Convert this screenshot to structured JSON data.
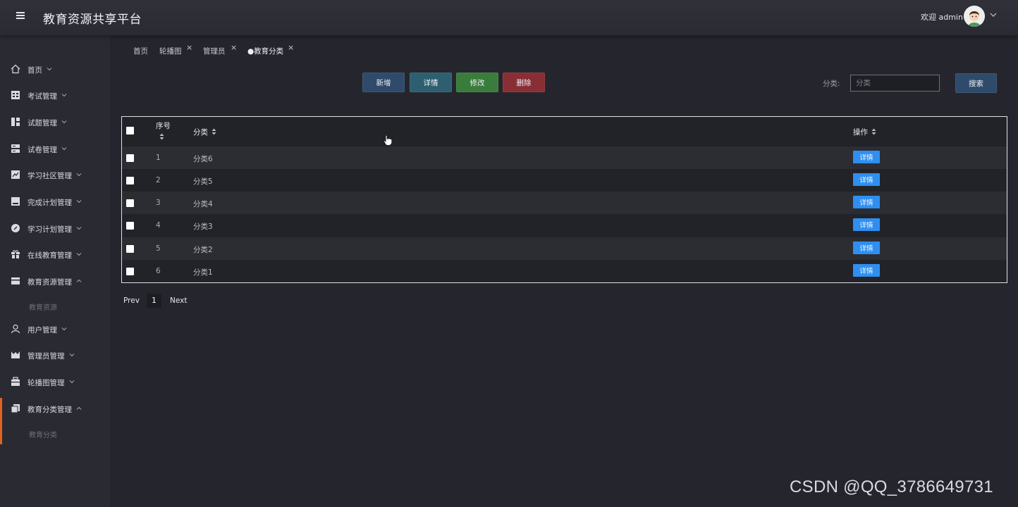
{
  "header": {
    "title": "教育资源共享平台",
    "welcome": "欢迎 admin"
  },
  "sidebar": {
    "items": [
      {
        "label": "首页",
        "icon": "home-icon"
      },
      {
        "label": "考试管理",
        "icon": "exam-icon"
      },
      {
        "label": "试题管理",
        "icon": "question-icon"
      },
      {
        "label": "试卷管理",
        "icon": "paper-icon"
      },
      {
        "label": "学习社区管理",
        "icon": "community-icon"
      },
      {
        "label": "完成计划管理",
        "icon": "plan-done-icon"
      },
      {
        "label": "学习计划管理",
        "icon": "study-plan-icon"
      },
      {
        "label": "在线教育管理",
        "icon": "gift-icon"
      },
      {
        "label": "教育资源管理",
        "icon": "resource-icon",
        "sub": "教育资源"
      },
      {
        "label": "用户管理",
        "icon": "user-icon"
      },
      {
        "label": "管理员管理",
        "icon": "admin-icon"
      },
      {
        "label": "轮播图管理",
        "icon": "carousel-icon"
      },
      {
        "label": "教育分类管理",
        "icon": "category-icon",
        "sub": "教育分类"
      }
    ]
  },
  "tabs": [
    {
      "label": "首页"
    },
    {
      "label": "轮播图"
    },
    {
      "label": "管理员"
    },
    {
      "label": "●教育分类"
    }
  ],
  "toolbar": {
    "add": "新增",
    "detail": "详情",
    "edit": "修改",
    "delete": "删除",
    "filter_label": "分类:",
    "filter_placeholder": "分类",
    "search": "搜索"
  },
  "table": {
    "headers": {
      "num": "序号",
      "category": "分类",
      "action": "操作"
    },
    "rows": [
      {
        "num": "1",
        "category": "分类6",
        "action": "详情"
      },
      {
        "num": "2",
        "category": "分类5",
        "action": "详情"
      },
      {
        "num": "3",
        "category": "分类4",
        "action": "详情"
      },
      {
        "num": "4",
        "category": "分类3",
        "action": "详情"
      },
      {
        "num": "5",
        "category": "分类2",
        "action": "详情"
      },
      {
        "num": "6",
        "category": "分类1",
        "action": "详情"
      }
    ]
  },
  "pager": {
    "prev": "Prev",
    "current": "1",
    "next": "Next"
  },
  "watermark": "CSDN @QQ_3786649731",
  "colors": {
    "background": "#25262d",
    "sidebar": "#2a2b32",
    "accent": "#e2631f",
    "row_button": "#2f8ff0",
    "add_button": "#2f4a6b",
    "detail_button": "#2e5f70",
    "edit_button": "#3a7c3c",
    "delete_button": "#8a2e35"
  }
}
